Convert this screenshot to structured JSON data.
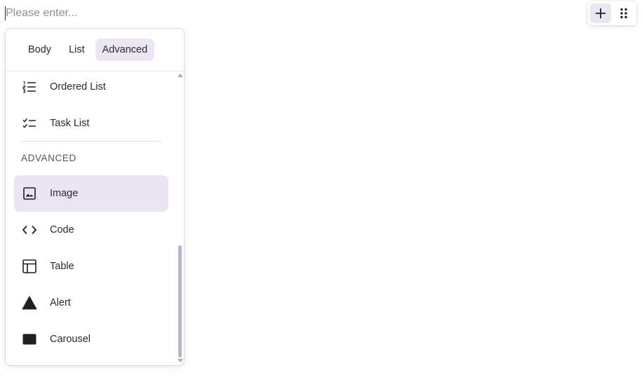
{
  "editor": {
    "placeholder": "Please enter..."
  },
  "toolbar": {
    "add_icon": "plus-icon",
    "drag_icon": "drag-handle-icon"
  },
  "menu": {
    "tabs": [
      {
        "label": "Body",
        "active": false
      },
      {
        "label": "List",
        "active": false
      },
      {
        "label": "Advanced",
        "active": true
      }
    ],
    "items": [
      {
        "label": "Ordered List",
        "icon": "ordered-list-icon",
        "active": false
      },
      {
        "label": "Task List",
        "icon": "task-list-icon",
        "active": false
      },
      {
        "label": "Image",
        "icon": "image-icon",
        "active": true
      },
      {
        "label": "Code",
        "icon": "code-icon",
        "active": false
      },
      {
        "label": "Table",
        "icon": "table-icon",
        "active": false
      },
      {
        "label": "Alert",
        "icon": "alert-icon",
        "active": false
      },
      {
        "label": "Carousel",
        "icon": "carousel-icon",
        "active": false
      }
    ],
    "section_heading": "ADVANCED"
  },
  "colors": {
    "accent_bg": "#ece6f4",
    "scroll_thumb": "#b9b2cd"
  }
}
